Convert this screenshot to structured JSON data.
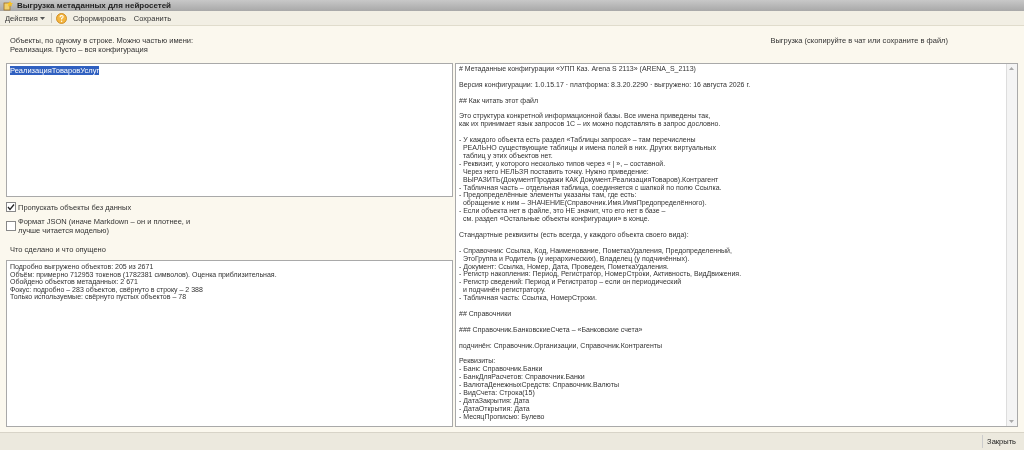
{
  "window": {
    "title": "Выгрузка метаданных для нейросетей"
  },
  "toolbar": {
    "actions_menu": "Действия",
    "buttons": [
      "Сформировать",
      "Сохранить"
    ]
  },
  "objects": {
    "hint": [
      "Объекты, по одному в строке. Можно частью имени:",
      "Реализация. Пусто – вся конфигурация"
    ],
    "value": "РеализацияТоваровУслуг"
  },
  "options": [
    {
      "label": "Пропускать объекты без данных",
      "checked": true
    },
    {
      "label": "Формат JSON (иначе Markdown – он и плотнее, и лучше читается моделью)",
      "checked": false
    }
  ],
  "report": {
    "label": "Что сделано и что опущено",
    "lines": [
      "Подробно выгружено объектов: 205 из 2671",
      "Объём: примерно 712953 токенов (1782381 символов). Оценка приблизительная.",
      "Обойдено объектов метаданных: 2 671",
      "Фокус: подробно – 283 объектов, свёрнуто в строку – 2 388",
      "Только используемые: свёрнуто пустых объектов – 78"
    ]
  },
  "output": {
    "label": "Выгрузка (скопируйте в чат или сохраните в файл)",
    "paragraphs": [
      [
        "# Метаданные конфигурации «УПП Каз. Arena S 2113» (ARENA_S_2113)"
      ],
      [
        "Версия конфигурации: 1.0.15.17 · платформа: 8.3.20.2290 · выгружено: 16 августа 2026 г."
      ],
      [
        "## Как читать этот файл"
      ],
      [
        "Это структура конкретной информационной базы. Все имена приведены так,",
        "как их принимает язык запросов 1С – их можно подставлять в запрос дословно."
      ],
      [
        "- У каждого объекта есть раздел «Таблицы запроса» – там перечислены",
        "  РЕАЛЬНО существующие таблицы и имена полей в них. Других виртуальных",
        "  таблиц у этих объектов нет.",
        "- Реквизит, у которого несколько типов через « | », – составной.",
        "  Через него НЕЛЬЗЯ поставить точку. Нужно приведение:",
        "  ВЫРАЗИТЬ(ДокументПродажи КАК Документ.РеализацияТоваров).Контрагент",
        "- Табличная часть – отдельная таблица, соединяется с шапкой по полю Ссылка.",
        "- Предопределённые элементы указаны там, где есть:",
        "  обращение к ним – ЗНАЧЕНИЕ(Справочник.Имя.ИмяПредопределённого).",
        "- Если объекта нет в файле, это НЕ значит, что его нет в базе –",
        "  см. раздел «Остальные объекты конфигурации» в конце."
      ],
      [
        "Стандартные реквизиты (есть всегда, у каждого объекта своего вида):"
      ],
      [
        "- Справочник: Ссылка, Код, Наименование, ПометкаУдаления, Предопределенный,",
        "  ЭтоГруппа и Родитель (у иерархических), Владелец (у подчинённых).",
        "- Документ: Ссылка, Номер, Дата, Проведен, ПометкаУдаления.",
        "- Регистр накопления: Период, Регистратор, НомерСтроки, Активность, ВидДвижения.",
        "- Регистр сведений: Период и Регистратор – если он периодический",
        "  и подчинён регистратору.",
        "- Табличная часть: Ссылка, НомерСтроки."
      ],
      [
        "## Справочники"
      ],
      [
        "### Справочник.БанковскиеСчета – «Банковские счета»"
      ],
      [
        "подчинён: Справочник.Организации, Справочник.Контрагенты"
      ],
      [
        "Реквизиты:",
        "- Банк: Справочник.Банки",
        "- БанкДляРасчетов: Справочник.Банки",
        "- ВалютаДенежныхСредств: Справочник.Валюты",
        "- ВидСчета: Строка(15)",
        "- ДатаЗакрытия: Дата",
        "- ДатаОткрытия: Дата",
        "- МесяцПрописью: Булево"
      ]
    ]
  },
  "footer": {
    "close_button": "Закрыть"
  }
}
